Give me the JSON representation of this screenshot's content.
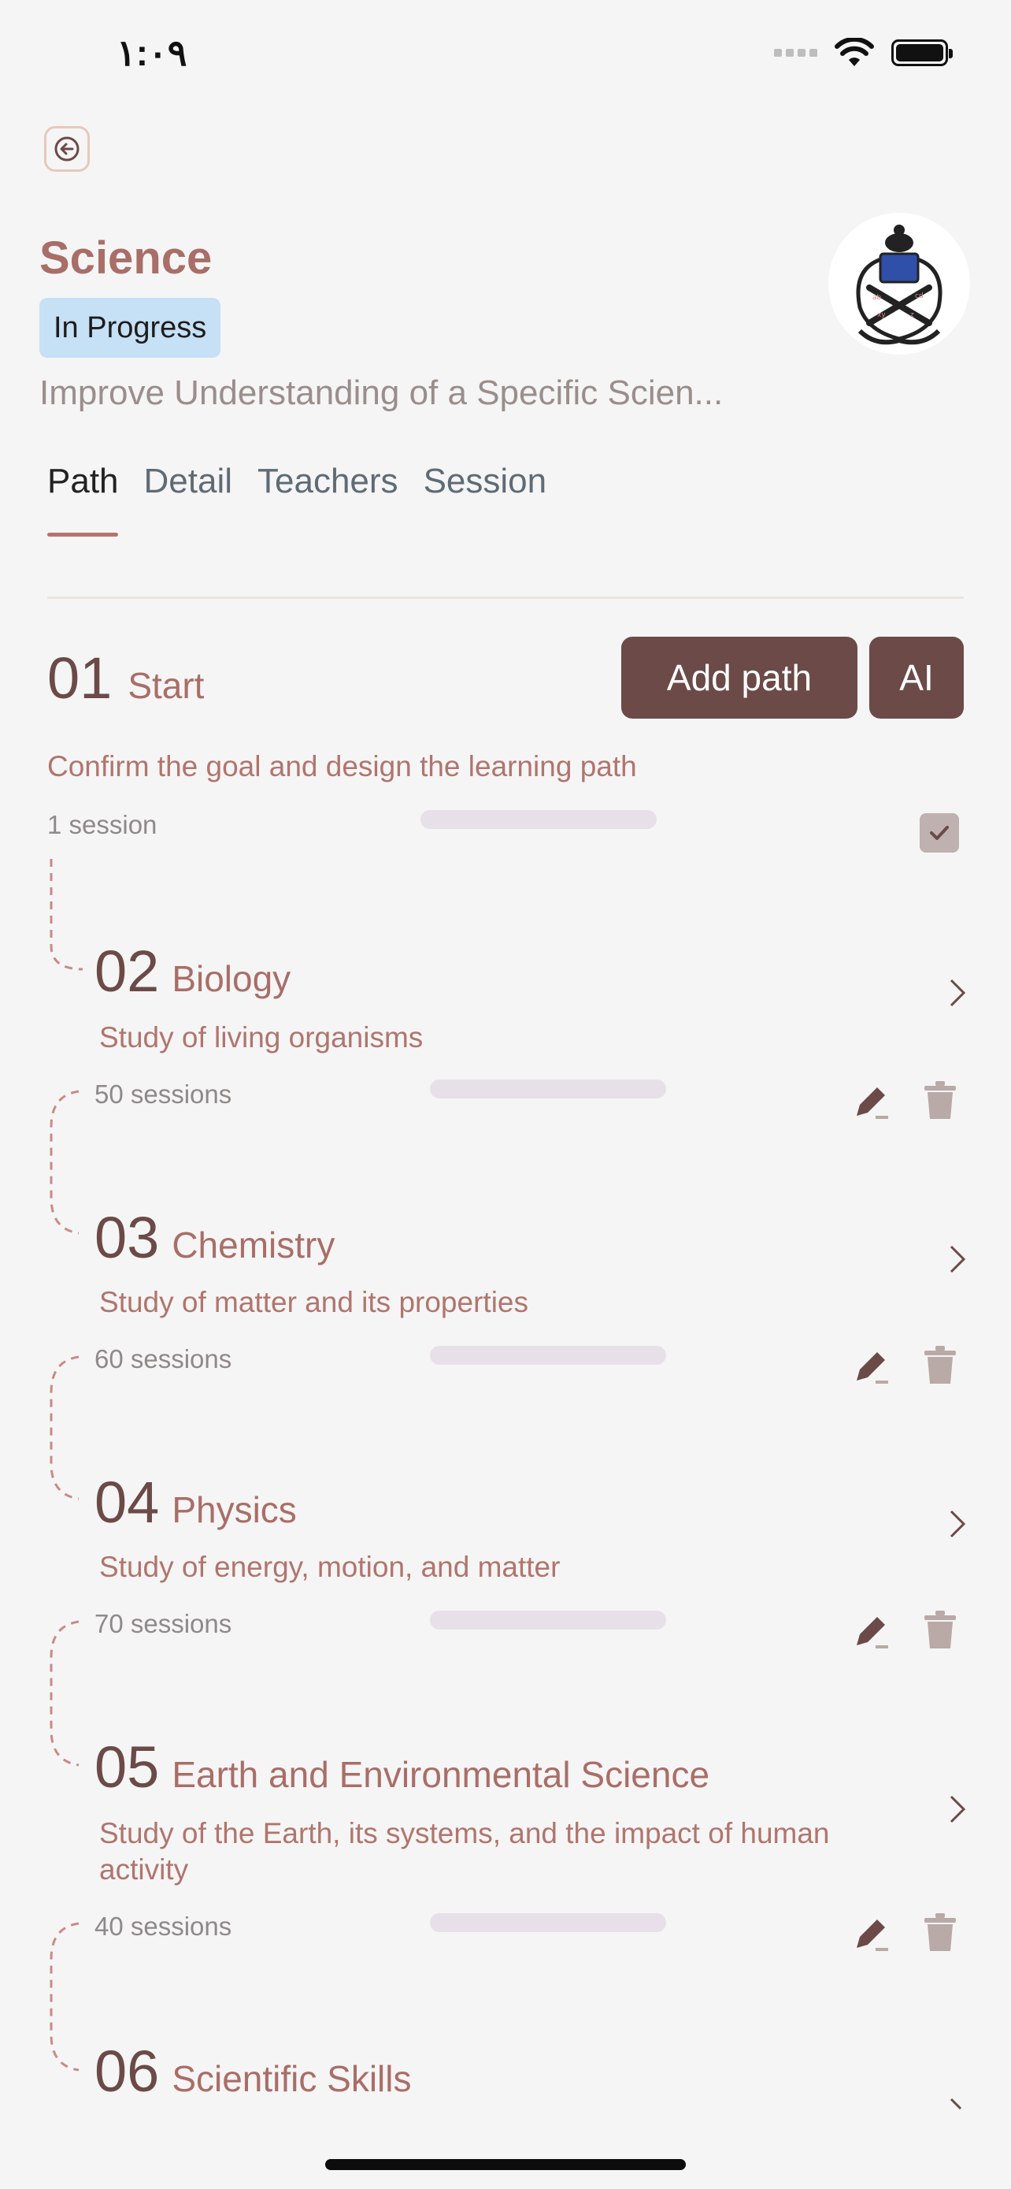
{
  "status_bar": {
    "time": "١:٠٩"
  },
  "header": {
    "title": "Science",
    "badge": "In Progress",
    "subtitle": "Improve Understanding of a Specific Scien..."
  },
  "tabs": [
    {
      "label": "Path",
      "active": true
    },
    {
      "label": "Detail",
      "active": false
    },
    {
      "label": "Teachers",
      "active": false
    },
    {
      "label": "Session",
      "active": false
    }
  ],
  "actions": {
    "add_path": "Add path",
    "ai": "AI"
  },
  "path": [
    {
      "num": "01",
      "title": "Start",
      "desc": "Confirm the goal and design the learning path",
      "sessions": "1 session",
      "completed": true
    },
    {
      "num": "02",
      "title": "Biology",
      "desc": "Study of living organisms",
      "sessions": "50 sessions"
    },
    {
      "num": "03",
      "title": "Chemistry",
      "desc": "Study of matter and its properties",
      "sessions": "60 sessions"
    },
    {
      "num": "04",
      "title": "Physics",
      "desc": "Study of energy, motion, and matter",
      "sessions": "70 sessions"
    },
    {
      "num": "05",
      "title": "Earth and Environmental Science",
      "desc": "Study of the Earth, its systems, and the impact of human activity",
      "sessions": "40 sessions"
    },
    {
      "num": "06",
      "title": "Scientific Skills"
    }
  ],
  "icons": {
    "back": "arrow-left-icon",
    "edit": "pencil-icon",
    "delete": "trash-icon",
    "open": "chevron-right-icon",
    "done": "check-icon"
  },
  "colors": {
    "accent": "#6b4a48",
    "title": "#a96e68",
    "badge_bg": "#c6e0f5",
    "progress_track": "#e8e0e8"
  }
}
